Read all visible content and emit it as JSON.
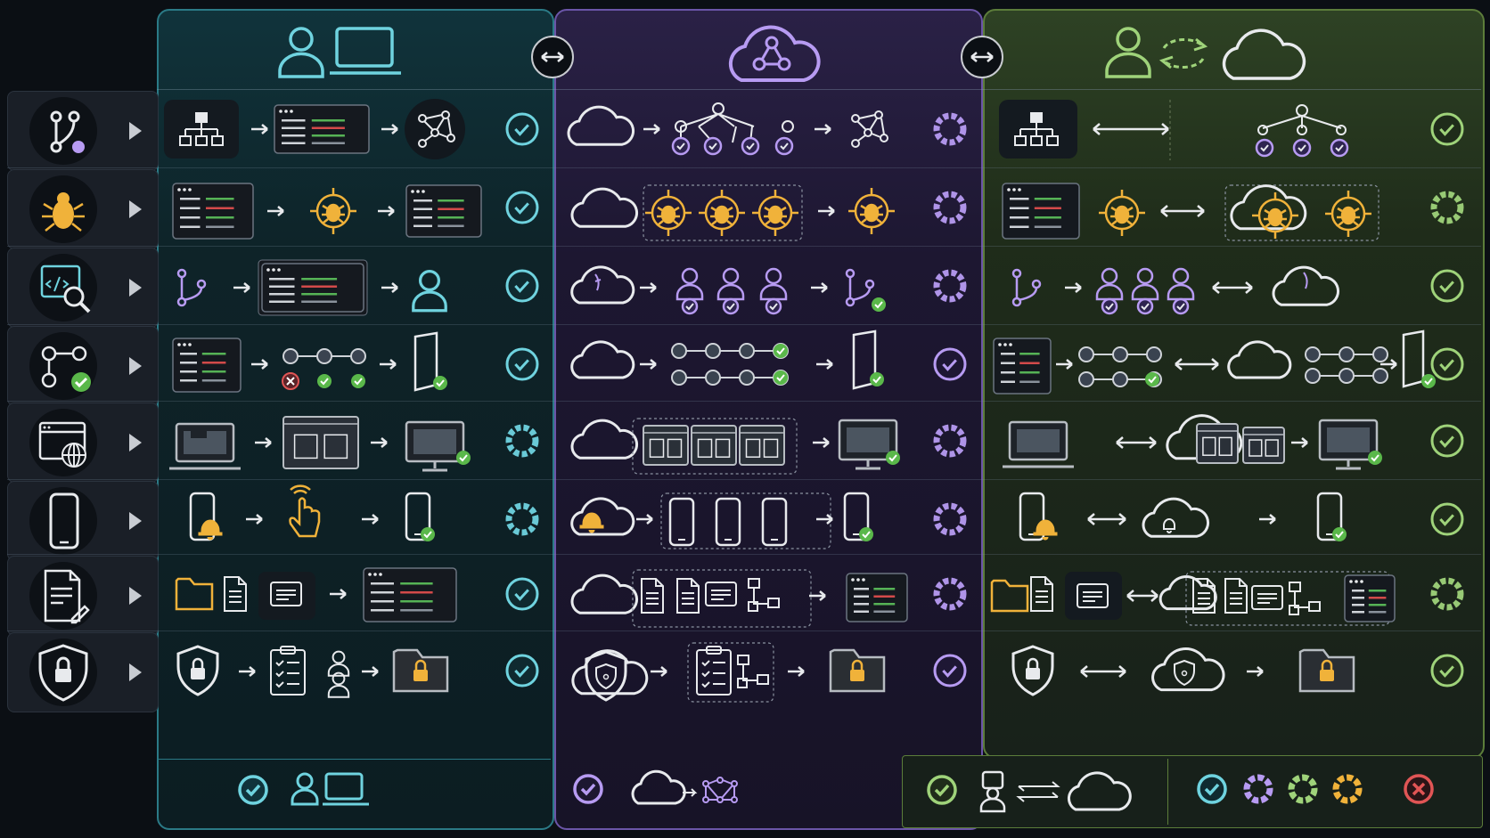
{
  "columns": [
    {
      "id": "local",
      "header_icons": [
        "user-icon",
        "laptop-icon"
      ],
      "accent": "#6fd3df"
    },
    {
      "id": "cloud",
      "header_icons": [
        "cloud-network-icon"
      ],
      "accent": "#b79bf2"
    },
    {
      "id": "hybrid",
      "header_icons": [
        "user-icon",
        "sync-arrows-icon",
        "cloud-icon"
      ],
      "accent": "#9fd37a"
    }
  ],
  "rows": [
    {
      "id": "branching",
      "icon": "git-branch-icon",
      "status": {
        "local": "done",
        "cloud": "in-progress",
        "hybrid": "done"
      }
    },
    {
      "id": "debugging",
      "icon": "bug-icon",
      "status": {
        "local": "done",
        "cloud": "in-progress",
        "hybrid": "in-progress"
      }
    },
    {
      "id": "code-review",
      "icon": "code-search-icon",
      "status": {
        "local": "done",
        "cloud": "in-progress",
        "hybrid": "done"
      }
    },
    {
      "id": "pipeline",
      "icon": "pipeline-check-icon",
      "status": {
        "local": "done",
        "cloud": "done",
        "hybrid": "done"
      }
    },
    {
      "id": "web-deploy",
      "icon": "web-globe-icon",
      "status": {
        "local": "in-progress",
        "cloud": "in-progress",
        "hybrid": "done"
      }
    },
    {
      "id": "mobile",
      "icon": "mobile-phone-icon",
      "status": {
        "local": "in-progress",
        "cloud": "in-progress",
        "hybrid": "done"
      }
    },
    {
      "id": "documents",
      "icon": "document-edit-icon",
      "status": {
        "local": "done",
        "cloud": "in-progress",
        "hybrid": "in-progress"
      }
    },
    {
      "id": "security",
      "icon": "shield-lock-icon",
      "status": {
        "local": "done",
        "cloud": "done",
        "hybrid": "done"
      }
    }
  ],
  "colors": {
    "teal": "#6fd3df",
    "purple": "#b79bf2",
    "green": "#9fd37a",
    "orange": "#f0b23a",
    "red": "#e05555",
    "check_green": "#5ab84a"
  },
  "legend": {
    "items": [
      "check-teal-icon",
      "progress-purple-icon",
      "progress-green-icon",
      "progress-orange-icon",
      "error-red-icon"
    ]
  }
}
